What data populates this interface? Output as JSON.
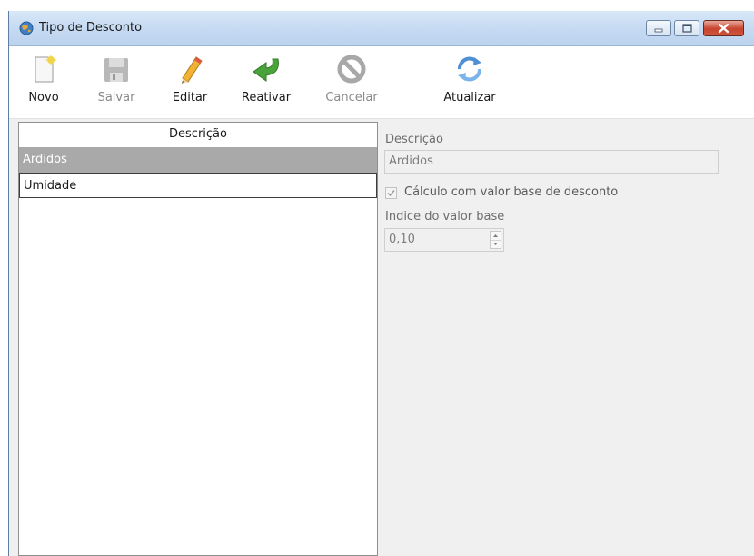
{
  "window": {
    "title": "Tipo de Desconto",
    "icon": "app-globe-icon",
    "controls": [
      "minimize-icon",
      "maximize-icon",
      "close-icon"
    ]
  },
  "toolbar": {
    "novo": {
      "label": "Novo",
      "icon": "new-document-icon",
      "enabled": true
    },
    "salvar": {
      "label": "Salvar",
      "icon": "floppy-disk-icon",
      "enabled": false
    },
    "editar": {
      "label": "Editar",
      "icon": "pencil-icon",
      "enabled": true
    },
    "reativar": {
      "label": "Reativar",
      "icon": "green-undo-arrow-icon",
      "enabled": true
    },
    "cancelar": {
      "label": "Cancelar",
      "icon": "cancel-circle-icon",
      "enabled": false
    },
    "atualizar": {
      "label": "Atualizar",
      "icon": "refresh-icon",
      "enabled": true
    }
  },
  "list": {
    "header": "Descrição",
    "rows": [
      {
        "label": "Ardidos",
        "selected": true
      },
      {
        "label": "Umidade",
        "selected": false
      }
    ]
  },
  "form": {
    "descricao_label": "Descrição",
    "descricao_value": "Ardidos",
    "calculo_label": "Cálculo com valor base de desconto",
    "calculo_checked": true,
    "indice_label": "Indice do valor base",
    "indice_value": "0,10"
  },
  "colors": {
    "selected_row": "#a9a9a9",
    "titlebar": "#c6daf2",
    "close_button": "#c7432e",
    "reativar_green": "#4aa33a"
  }
}
